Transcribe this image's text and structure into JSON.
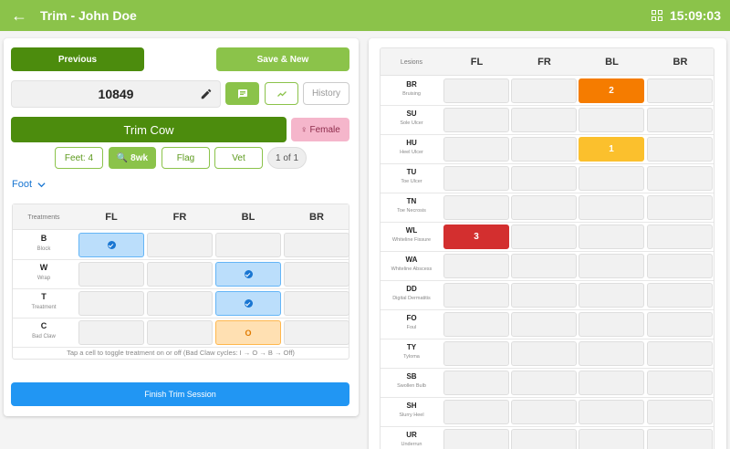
{
  "header": {
    "title": "Trim - John Doe",
    "time": "15:09:03",
    "back_icon": "arrow-left-icon",
    "grid_icon": "grid-view-icon"
  },
  "nav": {
    "previous_label": "Previous",
    "save_new_label": "Save & New"
  },
  "cow": {
    "id": "10849",
    "history_label": "History",
    "trim_label": "Trim Cow",
    "sex_label": "♀ Female"
  },
  "chips": {
    "feet": "Feet: 4",
    "bwk": "🔍 8wk",
    "flag": "Flag",
    "vet": "Vet",
    "count": "1 of 1"
  },
  "foot_select": "Foot",
  "treatments": {
    "header_label": "Treatments",
    "columns": [
      "FL",
      "FR",
      "BL",
      "BR"
    ],
    "rows": [
      {
        "code": "B",
        "desc": "Block",
        "cells": [
          "check",
          "",
          "",
          ""
        ]
      },
      {
        "code": "W",
        "desc": "Wrap",
        "cells": [
          "",
          "",
          "check",
          ""
        ]
      },
      {
        "code": "T",
        "desc": "Treatment",
        "cells": [
          "",
          "",
          "check",
          ""
        ]
      },
      {
        "code": "C",
        "desc": "Bad Claw",
        "cells": [
          "",
          "",
          "O",
          ""
        ]
      }
    ],
    "hint": "Tap a cell to toggle treatment on or off (Bad Claw cycles: I → O → B → Off)"
  },
  "finish_label": "Finish Trim Session",
  "lesions": {
    "header_label": "Lesions",
    "columns": [
      "FL",
      "FR",
      "BL",
      "BR"
    ],
    "rows": [
      {
        "code": "BR",
        "desc": "Bruising",
        "cells": [
          "",
          "",
          "2",
          ""
        ]
      },
      {
        "code": "SU",
        "desc": "Sole Ulcer",
        "cells": [
          "",
          "",
          "",
          ""
        ]
      },
      {
        "code": "HU",
        "desc": "Heel Ulcer",
        "cells": [
          "",
          "",
          "1",
          ""
        ]
      },
      {
        "code": "TU",
        "desc": "Toe Ulcer",
        "cells": [
          "",
          "",
          "",
          ""
        ]
      },
      {
        "code": "TN",
        "desc": "Toe Necrosis",
        "cells": [
          "",
          "",
          "",
          ""
        ]
      },
      {
        "code": "WL",
        "desc": "Whiteline Fissure",
        "cells": [
          "3",
          "",
          "",
          ""
        ]
      },
      {
        "code": "WA",
        "desc": "Whiteline Abscess",
        "cells": [
          "",
          "",
          "",
          ""
        ]
      },
      {
        "code": "DD",
        "desc": "Digital Dermatitis",
        "cells": [
          "",
          "",
          "",
          ""
        ]
      },
      {
        "code": "FO",
        "desc": "Foul",
        "cells": [
          "",
          "",
          "",
          ""
        ]
      },
      {
        "code": "TY",
        "desc": "Tyloma",
        "cells": [
          "",
          "",
          "",
          ""
        ]
      },
      {
        "code": "SB",
        "desc": "Swollen Bulb",
        "cells": [
          "",
          "",
          "",
          ""
        ]
      },
      {
        "code": "SH",
        "desc": "Slurry Heel",
        "cells": [
          "",
          "",
          "",
          ""
        ]
      },
      {
        "code": "UR",
        "desc": "Underrun",
        "cells": [
          "",
          "",
          "",
          ""
        ]
      }
    ],
    "score_colors": {
      "1": "#fbc02d",
      "2": "#f57c00",
      "3": "#d32f2f"
    }
  },
  "colors": {
    "primary": "#8bc34a",
    "primary_dark": "#4c8c0d",
    "accent_blue": "#2196f3"
  }
}
